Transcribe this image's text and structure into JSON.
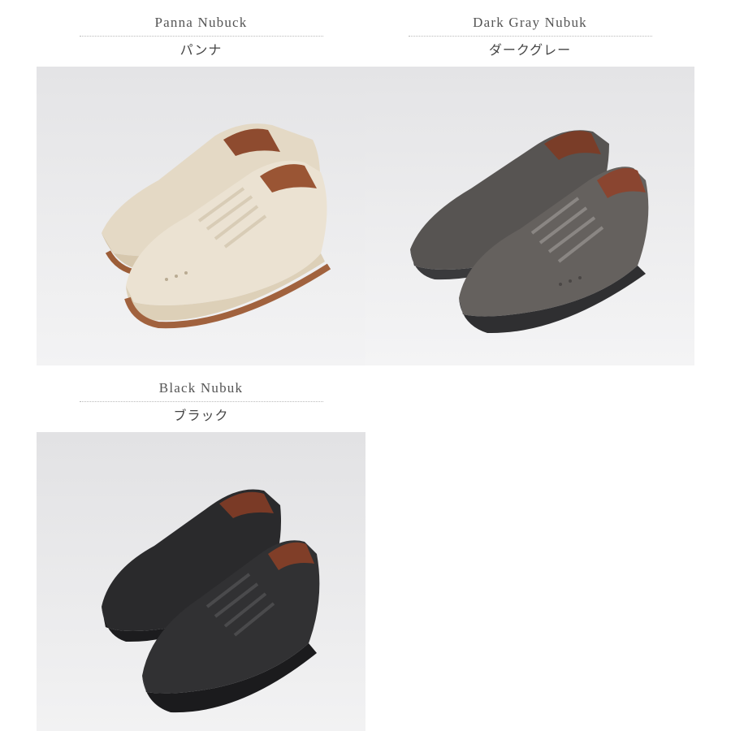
{
  "products": [
    {
      "name_en": "Panna Nubuck",
      "name_jp": "パンナ",
      "upper_color": "#e7ddcb",
      "sole_color": "#a1623e"
    },
    {
      "name_en": "Dark Gray Nubuk",
      "name_jp": "ダークグレー",
      "upper_color": "#5f5c5a",
      "sole_color": "#2e2e30"
    },
    {
      "name_en": "Black Nubuk",
      "name_jp": "ブラック",
      "upper_color": "#2c2c2e",
      "sole_color": "#1e1e20"
    }
  ]
}
